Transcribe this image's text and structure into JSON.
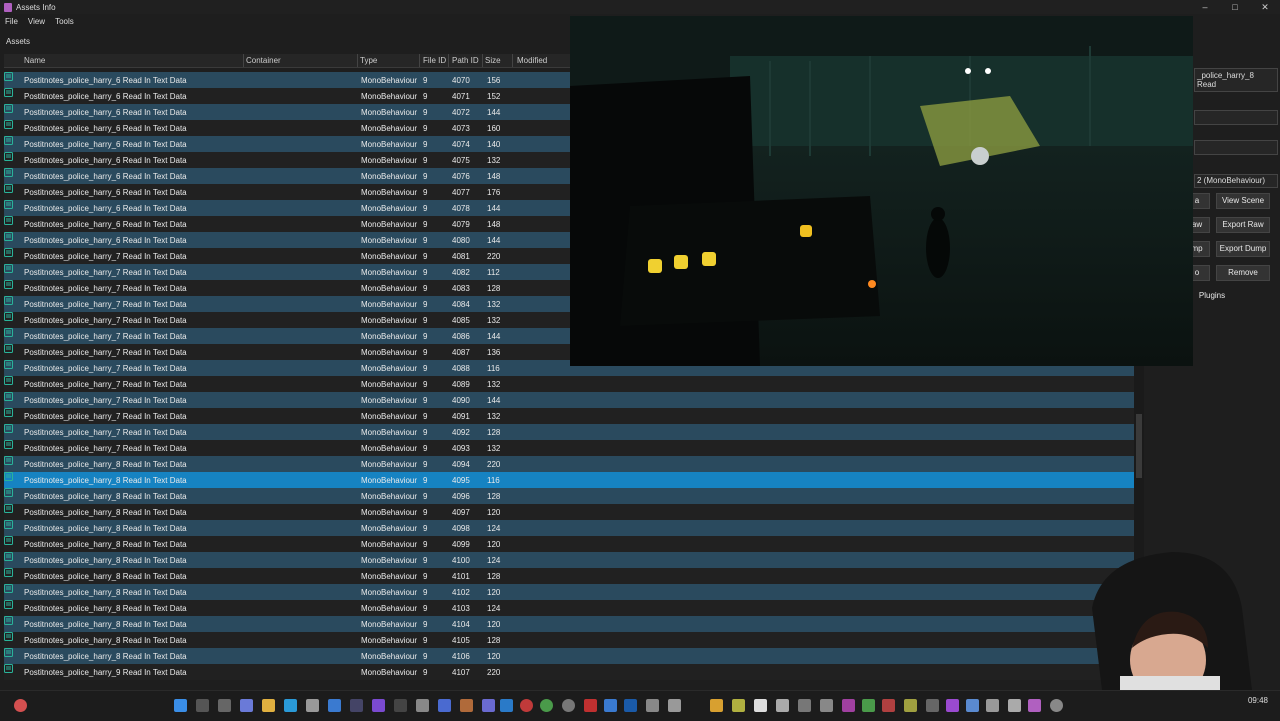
{
  "window": {
    "title": "Assets Info"
  },
  "menu": [
    "File",
    "View",
    "Tools"
  ],
  "panel_label": "Assets",
  "columns": {
    "name": "Name",
    "container": "Container",
    "type": "Type",
    "file_id": "File ID",
    "path_id": "Path ID",
    "size": "Size",
    "modified": "Modified"
  },
  "rows": [
    {
      "name": "Postitnotes_police_harry_6 Read In Text Data",
      "type": "MonoBehaviour",
      "file_id": "9",
      "path_id": "4070",
      "size": "156"
    },
    {
      "name": "Postitnotes_police_harry_6 Read In Text Data",
      "type": "MonoBehaviour",
      "file_id": "9",
      "path_id": "4071",
      "size": "152"
    },
    {
      "name": "Postitnotes_police_harry_6 Read In Text Data",
      "type": "MonoBehaviour",
      "file_id": "9",
      "path_id": "4072",
      "size": "144"
    },
    {
      "name": "Postitnotes_police_harry_6 Read In Text Data",
      "type": "MonoBehaviour",
      "file_id": "9",
      "path_id": "4073",
      "size": "160"
    },
    {
      "name": "Postitnotes_police_harry_6 Read In Text Data",
      "type": "MonoBehaviour",
      "file_id": "9",
      "path_id": "4074",
      "size": "140"
    },
    {
      "name": "Postitnotes_police_harry_6 Read In Text Data",
      "type": "MonoBehaviour",
      "file_id": "9",
      "path_id": "4075",
      "size": "132"
    },
    {
      "name": "Postitnotes_police_harry_6 Read In Text Data",
      "type": "MonoBehaviour",
      "file_id": "9",
      "path_id": "4076",
      "size": "148"
    },
    {
      "name": "Postitnotes_police_harry_6 Read In Text Data",
      "type": "MonoBehaviour",
      "file_id": "9",
      "path_id": "4077",
      "size": "176"
    },
    {
      "name": "Postitnotes_police_harry_6 Read In Text Data",
      "type": "MonoBehaviour",
      "file_id": "9",
      "path_id": "4078",
      "size": "144"
    },
    {
      "name": "Postitnotes_police_harry_6 Read In Text Data",
      "type": "MonoBehaviour",
      "file_id": "9",
      "path_id": "4079",
      "size": "148"
    },
    {
      "name": "Postitnotes_police_harry_6 Read In Text Data",
      "type": "MonoBehaviour",
      "file_id": "9",
      "path_id": "4080",
      "size": "144"
    },
    {
      "name": "Postitnotes_police_harry_7 Read In Text Data",
      "type": "MonoBehaviour",
      "file_id": "9",
      "path_id": "4081",
      "size": "220"
    },
    {
      "name": "Postitnotes_police_harry_7 Read In Text Data",
      "type": "MonoBehaviour",
      "file_id": "9",
      "path_id": "4082",
      "size": "112"
    },
    {
      "name": "Postitnotes_police_harry_7 Read In Text Data",
      "type": "MonoBehaviour",
      "file_id": "9",
      "path_id": "4083",
      "size": "128"
    },
    {
      "name": "Postitnotes_police_harry_7 Read In Text Data",
      "type": "MonoBehaviour",
      "file_id": "9",
      "path_id": "4084",
      "size": "132"
    },
    {
      "name": "Postitnotes_police_harry_7 Read In Text Data",
      "type": "MonoBehaviour",
      "file_id": "9",
      "path_id": "4085",
      "size": "132"
    },
    {
      "name": "Postitnotes_police_harry_7 Read In Text Data",
      "type": "MonoBehaviour",
      "file_id": "9",
      "path_id": "4086",
      "size": "144"
    },
    {
      "name": "Postitnotes_police_harry_7 Read In Text Data",
      "type": "MonoBehaviour",
      "file_id": "9",
      "path_id": "4087",
      "size": "136"
    },
    {
      "name": "Postitnotes_police_harry_7 Read In Text Data",
      "type": "MonoBehaviour",
      "file_id": "9",
      "path_id": "4088",
      "size": "116"
    },
    {
      "name": "Postitnotes_police_harry_7 Read In Text Data",
      "type": "MonoBehaviour",
      "file_id": "9",
      "path_id": "4089",
      "size": "132"
    },
    {
      "name": "Postitnotes_police_harry_7 Read In Text Data",
      "type": "MonoBehaviour",
      "file_id": "9",
      "path_id": "4090",
      "size": "144"
    },
    {
      "name": "Postitnotes_police_harry_7 Read In Text Data",
      "type": "MonoBehaviour",
      "file_id": "9",
      "path_id": "4091",
      "size": "132"
    },
    {
      "name": "Postitnotes_police_harry_7 Read In Text Data",
      "type": "MonoBehaviour",
      "file_id": "9",
      "path_id": "4092",
      "size": "128"
    },
    {
      "name": "Postitnotes_police_harry_7 Read In Text Data",
      "type": "MonoBehaviour",
      "file_id": "9",
      "path_id": "4093",
      "size": "132"
    },
    {
      "name": "Postitnotes_police_harry_8 Read In Text Data",
      "type": "MonoBehaviour",
      "file_id": "9",
      "path_id": "4094",
      "size": "220"
    },
    {
      "name": "Postitnotes_police_harry_8 Read In Text Data",
      "type": "MonoBehaviour",
      "file_id": "9",
      "path_id": "4095",
      "size": "116",
      "selected": true
    },
    {
      "name": "Postitnotes_police_harry_8 Read In Text Data",
      "type": "MonoBehaviour",
      "file_id": "9",
      "path_id": "4096",
      "size": "128"
    },
    {
      "name": "Postitnotes_police_harry_8 Read In Text Data",
      "type": "MonoBehaviour",
      "file_id": "9",
      "path_id": "4097",
      "size": "120"
    },
    {
      "name": "Postitnotes_police_harry_8 Read In Text Data",
      "type": "MonoBehaviour",
      "file_id": "9",
      "path_id": "4098",
      "size": "124"
    },
    {
      "name": "Postitnotes_police_harry_8 Read In Text Data",
      "type": "MonoBehaviour",
      "file_id": "9",
      "path_id": "4099",
      "size": "120"
    },
    {
      "name": "Postitnotes_police_harry_8 Read In Text Data",
      "type": "MonoBehaviour",
      "file_id": "9",
      "path_id": "4100",
      "size": "124"
    },
    {
      "name": "Postitnotes_police_harry_8 Read In Text Data",
      "type": "MonoBehaviour",
      "file_id": "9",
      "path_id": "4101",
      "size": "128"
    },
    {
      "name": "Postitnotes_police_harry_8 Read In Text Data",
      "type": "MonoBehaviour",
      "file_id": "9",
      "path_id": "4102",
      "size": "120"
    },
    {
      "name": "Postitnotes_police_harry_8 Read In Text Data",
      "type": "MonoBehaviour",
      "file_id": "9",
      "path_id": "4103",
      "size": "124"
    },
    {
      "name": "Postitnotes_police_harry_8 Read In Text Data",
      "type": "MonoBehaviour",
      "file_id": "9",
      "path_id": "4104",
      "size": "120"
    },
    {
      "name": "Postitnotes_police_harry_8 Read In Text Data",
      "type": "MonoBehaviour",
      "file_id": "9",
      "path_id": "4105",
      "size": "128"
    },
    {
      "name": "Postitnotes_police_harry_8 Read In Text Data",
      "type": "MonoBehaviour",
      "file_id": "9",
      "path_id": "4106",
      "size": "120"
    },
    {
      "name": "Postitnotes_police_harry_9 Read In Text Data",
      "type": "MonoBehaviour",
      "file_id": "9",
      "path_id": "4107",
      "size": "220"
    }
  ],
  "details": {
    "name_value": "_police_harry_8 Read",
    "type_value": "2 (MonoBehaviour)",
    "buttons": {
      "view_data": "a",
      "view_scene": "View Scene",
      "export_raw_partial": "aw",
      "export_raw": "Export Raw",
      "export_dump_partial": "mp",
      "export_dump": "Export Dump",
      "info_partial": "o",
      "remove": "Remove",
      "plugins": "Plugins"
    }
  },
  "taskbar": {
    "clock": "09:48"
  },
  "colors": {
    "row_alt": "#2a4a5e",
    "row_selected": "#1683c2",
    "row_base": "#212121",
    "icon_teal": "#2ab39a"
  }
}
